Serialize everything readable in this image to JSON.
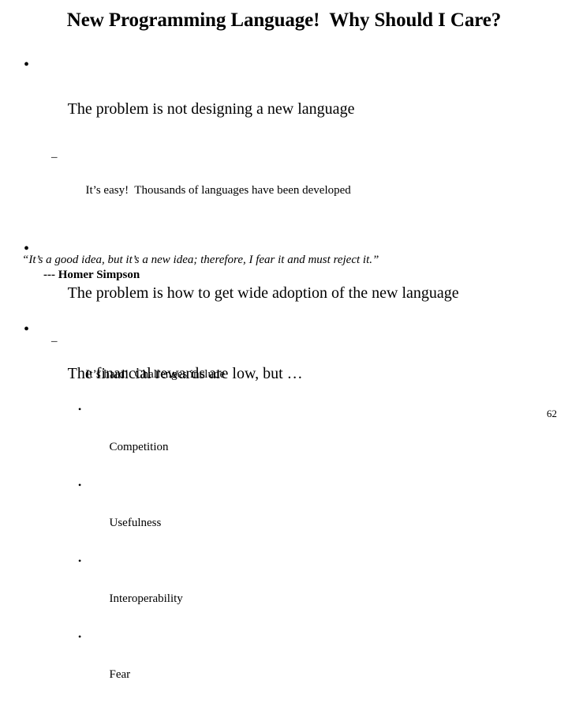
{
  "slide": {
    "title": "New Programming Language!  Why Should I Care?",
    "bullet_glyph_l1": "•",
    "bullet_glyph_l2": "–",
    "bullet_glyph_l3": "•",
    "points": [
      {
        "level": 1,
        "text": "The problem is not designing a new language"
      },
      {
        "level": 2,
        "text": "It’s easy!  Thousands of languages have been developed"
      },
      {
        "level": 1,
        "text": "The problem is how to get wide adoption of the new language"
      },
      {
        "level": 2,
        "text": "It’s hard!  Challenges include"
      },
      {
        "level": 3,
        "text": "Competition"
      },
      {
        "level": 3,
        "text": "Usefulness"
      },
      {
        "level": 3,
        "text": "Interoperability"
      },
      {
        "level": 3,
        "text": "Fear"
      }
    ],
    "quote": {
      "text": "“It’s a good idea, but it’s a new idea; therefore, I fear it and must reject it.”",
      "attribution": "--- Homer Simpson"
    },
    "closing_point": {
      "level": 1,
      "text": "The financial rewards are low, but …"
    },
    "page_number": "62",
    "text_color": "#000000",
    "background_color": "#ffffff"
  }
}
